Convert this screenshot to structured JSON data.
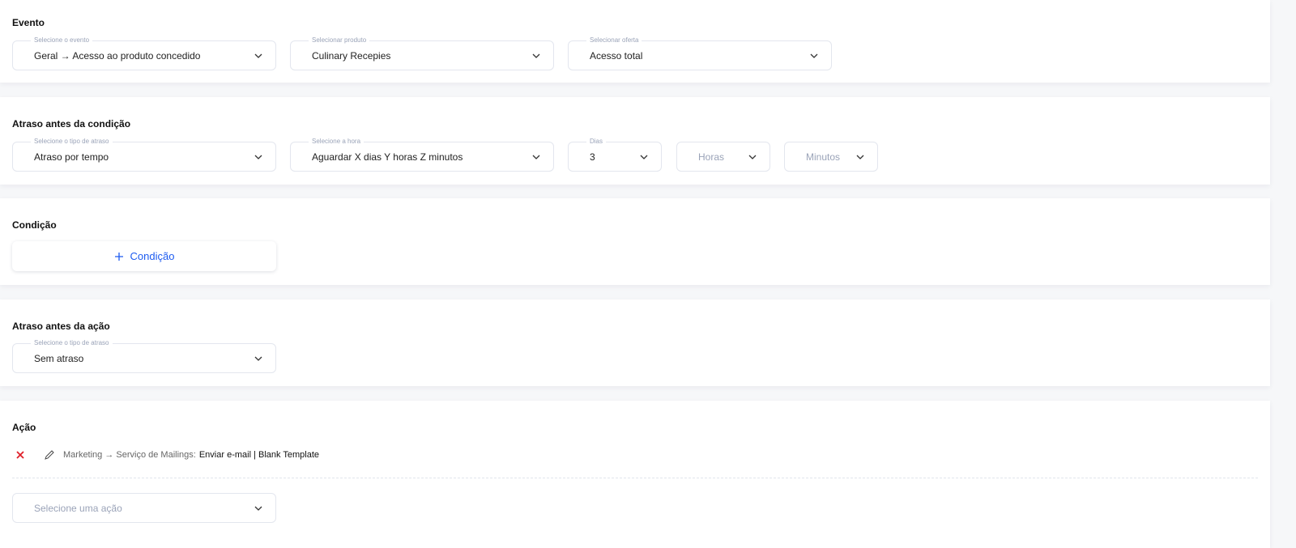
{
  "evento": {
    "title": "Evento",
    "event": {
      "label": "Selecione o evento",
      "value": "Geral → Acesso ao produto concedido"
    },
    "product": {
      "label": "Selecionar produto",
      "value": "Culinary Recepies"
    },
    "offer": {
      "label": "Selecionar oferta",
      "value": "Acesso total"
    }
  },
  "delay_condition": {
    "title": "Atraso antes da condição",
    "type": {
      "label": "Selecione o tipo de atraso",
      "value": "Atraso por tempo"
    },
    "hour": {
      "label": "Selecione a hora",
      "value": "Aguardar X dias Y horas Z minutos"
    },
    "days": {
      "label": "Dias",
      "value": "3"
    },
    "hours": {
      "placeholder": "Horas"
    },
    "minutes": {
      "placeholder": "Minutos"
    }
  },
  "condition": {
    "title": "Condição",
    "add_label": "Condição",
    "add_icon": "plus-icon"
  },
  "delay_action": {
    "title": "Atraso antes da ação",
    "type": {
      "label": "Selecione o tipo de atraso",
      "value": "Sem atraso"
    }
  },
  "action": {
    "title": "Ação",
    "item": {
      "path": "Marketing → Serviço de Mailings:",
      "name": "Enviar e-mail | Blank Template"
    },
    "select": {
      "placeholder": "Selecione uma ação"
    },
    "delete_color": "#e0202a",
    "accent": "#1d5bf0"
  }
}
